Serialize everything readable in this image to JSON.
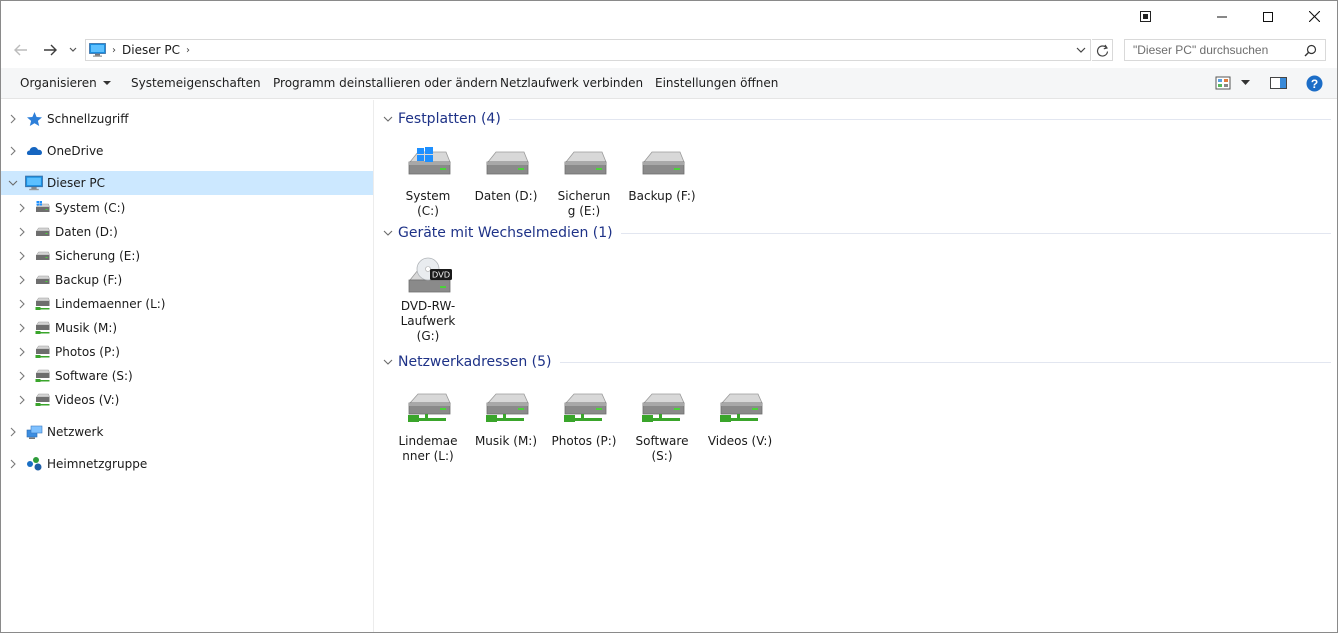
{
  "window": {
    "minimize_icon": "minimize-icon",
    "maximize_icon": "maximize-icon",
    "close_icon": "close-icon"
  },
  "address_bar": {
    "location": "Dieser PC",
    "search_placeholder": "\"Dieser PC\" durchsuchen"
  },
  "commands": {
    "organize": "Organisieren",
    "system_properties": "Systemeigenschaften",
    "uninstall": "Programm deinstallieren oder ändern",
    "map_drive": "Netzlaufwerk verbinden",
    "open_settings": "Einstellungen öffnen"
  },
  "nav_pane": {
    "quick_access": "Schnellzugriff",
    "onedrive": "OneDrive",
    "this_pc": "Dieser PC",
    "drives": [
      "System (C:)",
      "Daten (D:)",
      "Sicherung (E:)",
      "Backup (F:)",
      "Lindemaenner (L:)",
      "Musik (M:)",
      "Photos (P:)",
      "Software (S:)",
      "Videos (V:)"
    ],
    "network": "Netzwerk",
    "homegroup": "Heimnetzgruppe"
  },
  "groups": {
    "hard_disks": {
      "title": "Festplatten (4)",
      "items": [
        "System (C:)",
        "Daten (D:)",
        "Sicherung (E:)",
        "Backup (F:)"
      ]
    },
    "removable": {
      "title": "Geräte mit Wechselmedien (1)",
      "items": [
        "DVD-RW-Laufwerk (G:)"
      ],
      "dvd_badge": "DVD"
    },
    "network_locations": {
      "title": "Netzwerkadressen (5)",
      "items": [
        "Lindemaenner (L:)",
        "Musik (M:)",
        "Photos (P:)",
        "Software (S:)",
        "Videos (V:)"
      ]
    }
  },
  "colors": {
    "selection": "#cce8ff",
    "group_title": "#1e3287",
    "help": "#1c6dc7",
    "network_green": "#3aa52b"
  }
}
